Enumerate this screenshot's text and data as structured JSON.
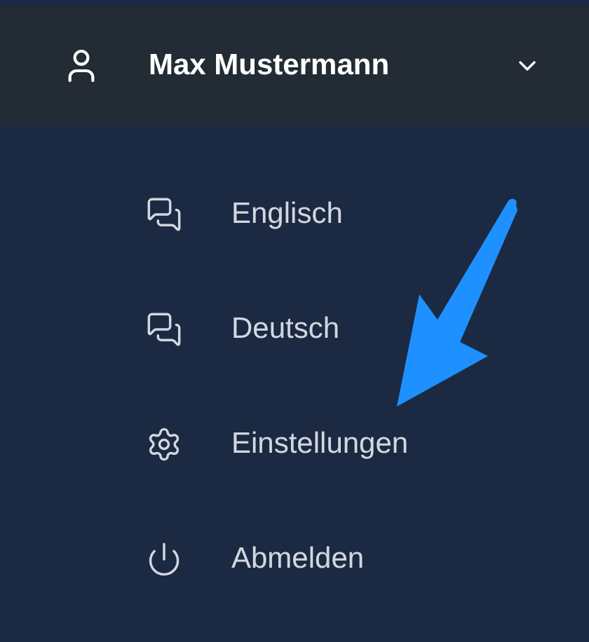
{
  "user_menu": {
    "name": "Max Mustermann",
    "expanded": true,
    "items": [
      {
        "kind": "chat",
        "label": "Englisch"
      },
      {
        "kind": "chat",
        "label": "Deutsch"
      },
      {
        "kind": "settings",
        "label": "Einstellungen"
      },
      {
        "kind": "power",
        "label": "Abmelden"
      }
    ]
  },
  "annotation": {
    "kind": "arrow",
    "color": "#1e90ff"
  }
}
